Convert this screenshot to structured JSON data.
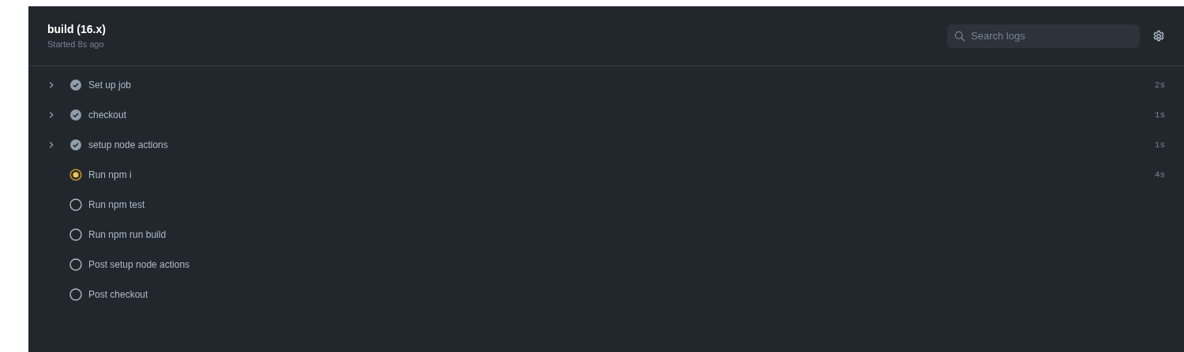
{
  "job": {
    "title": "build (16.x)",
    "subtitle": "Started 8s ago"
  },
  "search": {
    "placeholder": "Search logs"
  },
  "steps": [
    {
      "name": "Set up job",
      "kind": "success",
      "expandable": true,
      "duration": "2s"
    },
    {
      "name": "checkout",
      "kind": "success",
      "expandable": true,
      "duration": "1s"
    },
    {
      "name": "setup node actions",
      "kind": "success",
      "expandable": true,
      "duration": "1s"
    },
    {
      "name": "Run npm i",
      "kind": "running",
      "expandable": false,
      "duration": "4s"
    },
    {
      "name": "Run npm test",
      "kind": "queued",
      "expandable": false
    },
    {
      "name": "Run npm run build",
      "kind": "queued",
      "expandable": false
    },
    {
      "name": "Post setup node actions",
      "kind": "queued",
      "expandable": false
    },
    {
      "name": "Post checkout",
      "kind": "queued",
      "expandable": false
    }
  ]
}
